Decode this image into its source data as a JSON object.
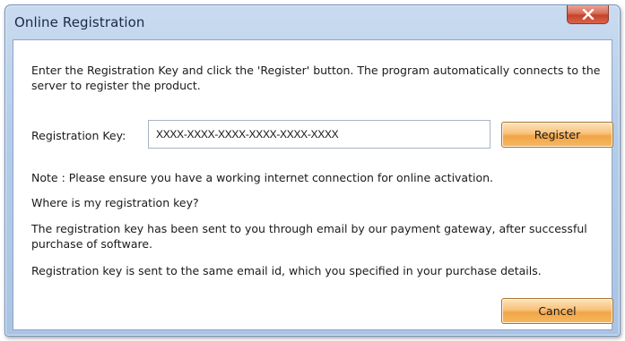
{
  "window": {
    "title": "Online Registration",
    "close_icon": "close-x-icon"
  },
  "dialog": {
    "intro": "Enter the Registration Key and click the 'Register' button. The program automatically connects to the server to register the product.",
    "key_label": "Registration Key:",
    "key_value": "XXXX-XXXX-XXXX-XXXX-XXXX-XXXX",
    "register_label": "Register",
    "note": "Note : Please ensure you have a working internet connection for online activation.",
    "where_question": "Where is my registration key?",
    "sent_info": "The registration key has been sent to you through email by our payment gateway, after successful purchase of software.",
    "same_email_info": "Registration key is sent to the same email id, which you specified in your purchase details.",
    "cancel_label": "Cancel"
  },
  "colors": {
    "button_orange": "#f1a548",
    "close_red": "#c5432a",
    "title_bar_blue": "#b4cce9"
  }
}
